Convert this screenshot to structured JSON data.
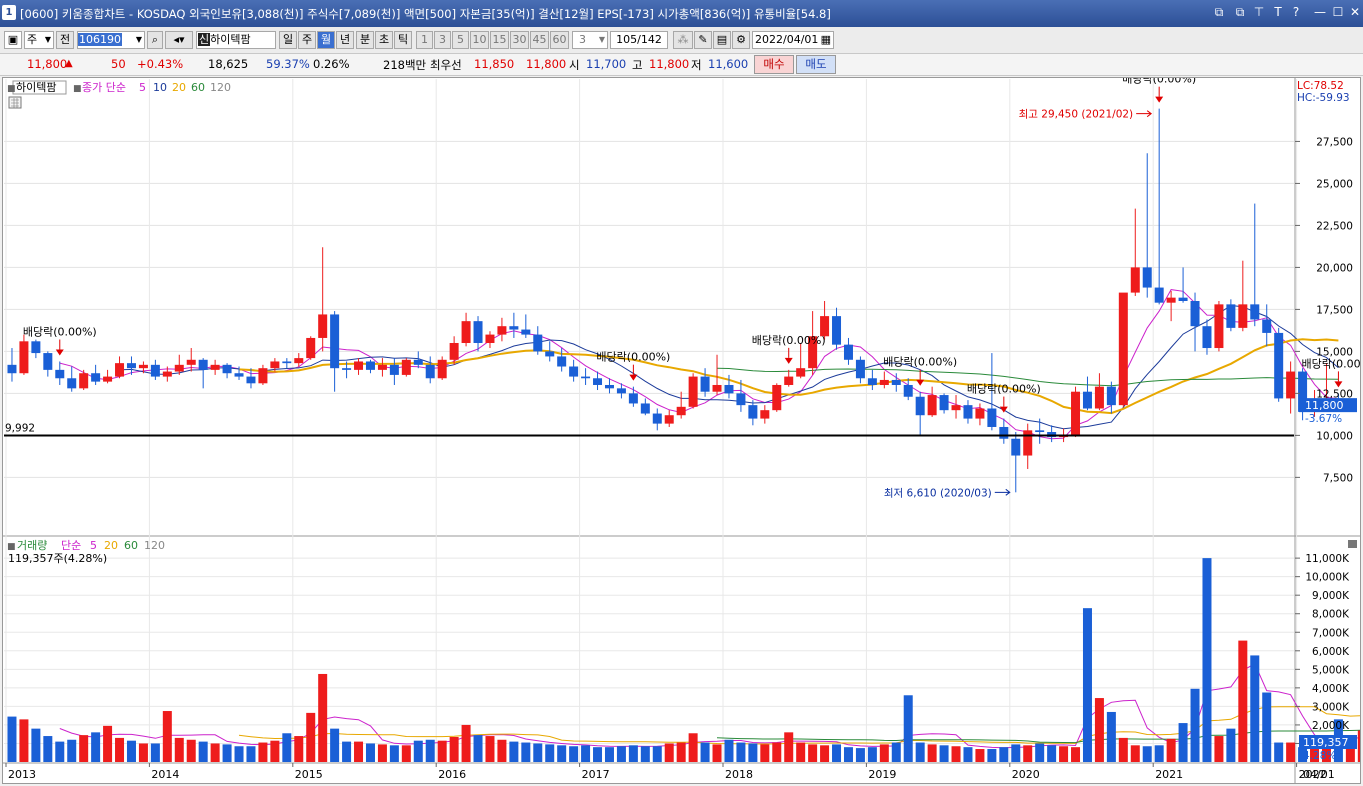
{
  "window": {
    "number": "1",
    "title": "[0600] 키움종합차트 - KOSDAQ 외국인보유[3,088(천)] 주식수[7,089(천)] 액면[500] 자본금[35(억)] 결산[12월] EPS[-173] 시가총액[836(억)] 유통비율[54.8]",
    "buttons": [
      "⧉",
      "⧉",
      "⊤",
      "T",
      "?",
      "—",
      "☐",
      "✕"
    ]
  },
  "toolbar": {
    "period_select": "주",
    "all_label": "전",
    "code_value": "106190",
    "stock_name": "하이텍팜",
    "stock_prefix": "신",
    "period_buttons": [
      "일",
      "주",
      "월",
      "년",
      "분",
      "초",
      "틱"
    ],
    "active_period": "월",
    "num_buttons": [
      "1",
      "3",
      "5",
      "10",
      "15",
      "30",
      "45",
      "60"
    ],
    "count_value": "3",
    "page_value": "105/142",
    "date_value": "2022/04/01"
  },
  "quote": {
    "price": "11,800",
    "change_arrow": "▲",
    "change": "50",
    "change_pct": "+0.43%",
    "volume": "18,625",
    "vol_ratio": "59.37%",
    "turnover": "0.26%",
    "amount": "218백만",
    "best_label": "최우선",
    "ask": "11,850",
    "bid": "11,800",
    "open_label": "시",
    "open": "11,700",
    "high_label": "고",
    "high": "11,800",
    "low_label": "저",
    "low": "11,600",
    "buy_label": "매수",
    "sell_label": "매도"
  },
  "price_panel": {
    "stock_tag": "하이텍팜",
    "legend_main": "종가 단순",
    "ma_labels": [
      "5",
      "10",
      "20",
      "60",
      "120"
    ],
    "lc_label": "LC:78.52",
    "hc_label": "HC:-59.93",
    "y_ticks": [
      "27,500",
      "25,000",
      "22,500",
      "20,000",
      "17,500",
      "15,000",
      "12,500",
      "10,000",
      "7,500"
    ],
    "current_label": "11,800",
    "current_pct": "-3.67%",
    "support_label": "9,992",
    "high_annotation": "최고 29,450 (2021/02)",
    "low_annotation": "최저 6,610 (2020/03)",
    "dividend_labels": [
      "배당락(0.00%)",
      "배당락(0.00%)",
      "배당락(0.00%)",
      "배당락(0.00%)",
      "배당락(0.00%)",
      "배당락(0.00%)"
    ]
  },
  "volume_panel": {
    "title": "거래량",
    "legend_main": "단순",
    "ma_labels": [
      "5",
      "20",
      "60",
      "120"
    ],
    "current_text": "119,357주(4.28%)",
    "current_label": "119,357",
    "current_pct": "4.28%",
    "y_ticks": [
      "11,000K",
      "10,000K",
      "9,000K",
      "8,000K",
      "7,000K",
      "6,000K",
      "5,000K",
      "4,000K",
      "3,000K",
      "2,000K",
      "1,000K"
    ]
  },
  "x_axis": {
    "labels": [
      "2013",
      "2014",
      "2015",
      "2016",
      "2017",
      "2018",
      "2019",
      "2020",
      "2021",
      "2022"
    ],
    "end_label": "04/01"
  },
  "colors": {
    "up": "#ee1c1c",
    "down": "#1a5fd6",
    "ma5": "#cc22cc",
    "ma10": "#1c3b9a",
    "ma20": "#e8a800",
    "ma60": "#2a8a3a",
    "ma120": "#888888"
  },
  "chart_data": {
    "type": "candlestick",
    "interval": "monthly",
    "series_start": "2013/01",
    "price_ohlc": [
      [
        14200,
        15200,
        13200,
        13700
      ],
      [
        13700,
        16000,
        13600,
        15600
      ],
      [
        15600,
        15700,
        14600,
        14900
      ],
      [
        14900,
        15000,
        13500,
        13900
      ],
      [
        13900,
        14400,
        13000,
        13400
      ],
      [
        13400,
        14100,
        12600,
        12800
      ],
      [
        12800,
        13900,
        12700,
        13700
      ],
      [
        13700,
        14200,
        13000,
        13200
      ],
      [
        13200,
        13900,
        13100,
        13500
      ],
      [
        13500,
        14700,
        13400,
        14300
      ],
      [
        14300,
        14700,
        13600,
        14000
      ],
      [
        14000,
        14400,
        13700,
        14200
      ],
      [
        14200,
        14500,
        13300,
        13500
      ],
      [
        13500,
        14100,
        13200,
        13800
      ],
      [
        13800,
        14800,
        13600,
        14200
      ],
      [
        14200,
        15200,
        13800,
        14500
      ],
      [
        14500,
        14600,
        12800,
        13900
      ],
      [
        13900,
        14500,
        13600,
        14200
      ],
      [
        14200,
        14300,
        13400,
        13700
      ],
      [
        13700,
        14100,
        13300,
        13500
      ],
      [
        13500,
        14000,
        12800,
        13100
      ],
      [
        13100,
        14200,
        13000,
        14000
      ],
      [
        14000,
        14600,
        13800,
        14400
      ],
      [
        14400,
        14600,
        14000,
        14300
      ],
      [
        14300,
        14900,
        14100,
        14600
      ],
      [
        14600,
        15900,
        14500,
        15800
      ],
      [
        15800,
        21200,
        15000,
        17200
      ],
      [
        17200,
        17400,
        12600,
        14000
      ],
      [
        14000,
        14400,
        13400,
        13900
      ],
      [
        13900,
        14600,
        13600,
        14400
      ],
      [
        14400,
        14500,
        13700,
        13900
      ],
      [
        13900,
        14600,
        13500,
        14200
      ],
      [
        14200,
        14600,
        13000,
        13600
      ],
      [
        13600,
        14600,
        13500,
        14500
      ],
      [
        14500,
        15000,
        14000,
        14200
      ],
      [
        14200,
        14700,
        13100,
        13400
      ],
      [
        13400,
        14700,
        13300,
        14500
      ],
      [
        14500,
        15900,
        14200,
        15500
      ],
      [
        15500,
        17300,
        15300,
        16800
      ],
      [
        16800,
        17100,
        15000,
        15500
      ],
      [
        15500,
        16200,
        15200,
        16000
      ],
      [
        16000,
        17000,
        15600,
        16500
      ],
      [
        16500,
        17300,
        15800,
        16300
      ],
      [
        16300,
        17200,
        15800,
        16000
      ],
      [
        16000,
        16500,
        14800,
        15000
      ],
      [
        15000,
        15600,
        14400,
        14700
      ],
      [
        14700,
        15200,
        13800,
        14100
      ],
      [
        14100,
        14500,
        13200,
        13500
      ],
      [
        13500,
        14000,
        13000,
        13400
      ],
      [
        13400,
        13800,
        12700,
        13000
      ],
      [
        13000,
        13400,
        12500,
        12800
      ],
      [
        12800,
        13100,
        12200,
        12500
      ],
      [
        12500,
        12900,
        11700,
        11900
      ],
      [
        11900,
        12200,
        11200,
        11300
      ],
      [
        11300,
        11600,
        10300,
        10700
      ],
      [
        10700,
        11500,
        10500,
        11200
      ],
      [
        11200,
        12600,
        11000,
        11700
      ],
      [
        11700,
        13700,
        11600,
        13500
      ],
      [
        13500,
        14000,
        12300,
        12600
      ],
      [
        12600,
        14800,
        12400,
        13000
      ],
      [
        13000,
        13600,
        12200,
        12500
      ],
      [
        12500,
        13300,
        11400,
        11800
      ],
      [
        11800,
        12100,
        10600,
        11000
      ],
      [
        11000,
        11800,
        10700,
        11500
      ],
      [
        11500,
        13100,
        11400,
        13000
      ],
      [
        13000,
        13900,
        12900,
        13500
      ],
      [
        13500,
        15500,
        13400,
        14000
      ],
      [
        14000,
        17400,
        13600,
        15900
      ],
      [
        15900,
        18000,
        15700,
        17100
      ],
      [
        17100,
        17600,
        15100,
        15400
      ],
      [
        15400,
        15800,
        14200,
        14500
      ],
      [
        14500,
        14700,
        13100,
        13400
      ],
      [
        13400,
        13900,
        12700,
        13000
      ],
      [
        13000,
        13800,
        12800,
        13300
      ],
      [
        13300,
        13700,
        12600,
        13000
      ],
      [
        13000,
        13400,
        12100,
        12300
      ],
      [
        12300,
        12600,
        10000,
        11200
      ],
      [
        11200,
        12900,
        11100,
        12400
      ],
      [
        12400,
        12500,
        11300,
        11500
      ],
      [
        11500,
        12400,
        11000,
        11800
      ],
      [
        11800,
        12100,
        10700,
        11000
      ],
      [
        11000,
        11900,
        10600,
        11600
      ],
      [
        11600,
        14900,
        10300,
        10500
      ],
      [
        10500,
        11000,
        9500,
        9800
      ],
      [
        9800,
        10200,
        6610,
        8800
      ],
      [
        8800,
        10700,
        8000,
        10300
      ],
      [
        10300,
        11000,
        9500,
        10200
      ],
      [
        10200,
        10600,
        9600,
        9900
      ],
      [
        9900,
        10400,
        9600,
        10000
      ],
      [
        10000,
        12900,
        9900,
        12600
      ],
      [
        12600,
        13500,
        11500,
        11600
      ],
      [
        11600,
        13700,
        11500,
        12900
      ],
      [
        12900,
        13200,
        11300,
        11800
      ],
      [
        11800,
        16600,
        11700,
        18500
      ],
      [
        18500,
        23500,
        18300,
        20000
      ],
      [
        20000,
        26800,
        18200,
        18800
      ],
      [
        18800,
        29450,
        17800,
        17900
      ],
      [
        17900,
        18600,
        16800,
        18200
      ],
      [
        18200,
        20000,
        17900,
        18000
      ],
      [
        18000,
        18500,
        15000,
        16500
      ],
      [
        16500,
        16900,
        14800,
        15200
      ],
      [
        15200,
        18000,
        15000,
        17800
      ],
      [
        17800,
        18100,
        16200,
        16400
      ],
      [
        16400,
        20400,
        16200,
        17800
      ],
      [
        17800,
        23800,
        16500,
        16900
      ],
      [
        16900,
        17800,
        15300,
        16100
      ],
      [
        16100,
        16400,
        12000,
        12200
      ],
      [
        12200,
        14400,
        11300,
        13800
      ],
      [
        13800,
        14000,
        10900,
        11400
      ],
      [
        11400,
        12700,
        11100,
        11700
      ],
      [
        11700,
        14300,
        11400,
        12200
      ],
      [
        12200,
        12500,
        11600,
        11800
      ]
    ],
    "volume_k": [
      2450,
      2300,
      1800,
      1400,
      1100,
      1200,
      1450,
      1600,
      1950,
      1300,
      1150,
      1000,
      1000,
      2750,
      1300,
      1200,
      1100,
      1000,
      950,
      850,
      850,
      1050,
      1150,
      1550,
      1400,
      2650,
      4750,
      1800,
      1100,
      1100,
      1000,
      950,
      900,
      900,
      1150,
      1200,
      1150,
      1350,
      2000,
      1450,
      1400,
      1200,
      1100,
      1050,
      1000,
      950,
      900,
      850,
      900,
      800,
      800,
      850,
      900,
      850,
      850,
      1000,
      1050,
      1550,
      1050,
      950,
      1200,
      1050,
      1000,
      950,
      1050,
      1600,
      1050,
      950,
      900,
      950,
      800,
      750,
      800,
      950,
      1050,
      3600,
      1050,
      950,
      900,
      850,
      800,
      700,
      700,
      800,
      950,
      900,
      1000,
      900,
      850,
      800,
      8300,
      3450,
      2700,
      1300,
      900,
      850,
      900,
      1250,
      2100,
      3950,
      11000,
      1400,
      1800,
      6550,
      5750,
      3750,
      1050,
      1050,
      800,
      700,
      850,
      2300,
      1300,
      1700,
      900,
      800,
      1200,
      900,
      700,
      650,
      950,
      3250,
      2800,
      250
    ],
    "ma_periods": [
      5,
      10,
      20,
      60,
      120
    ],
    "volume_ma_periods": [
      5,
      20,
      60,
      120
    ],
    "support_line": 9992,
    "annotations": [
      {
        "text": "최고 29,450 (2021/02)",
        "value": 29450,
        "date": "2021/02"
      },
      {
        "text": "최저 6,610 (2020/03)",
        "value": 6610,
        "date": "2020/03"
      }
    ],
    "dividend_months": [
      4,
      52,
      65,
      76,
      83,
      96,
      111
    ],
    "y_range": [
      5200,
      30800
    ],
    "volume_y_range": [
      0,
      11600
    ]
  }
}
